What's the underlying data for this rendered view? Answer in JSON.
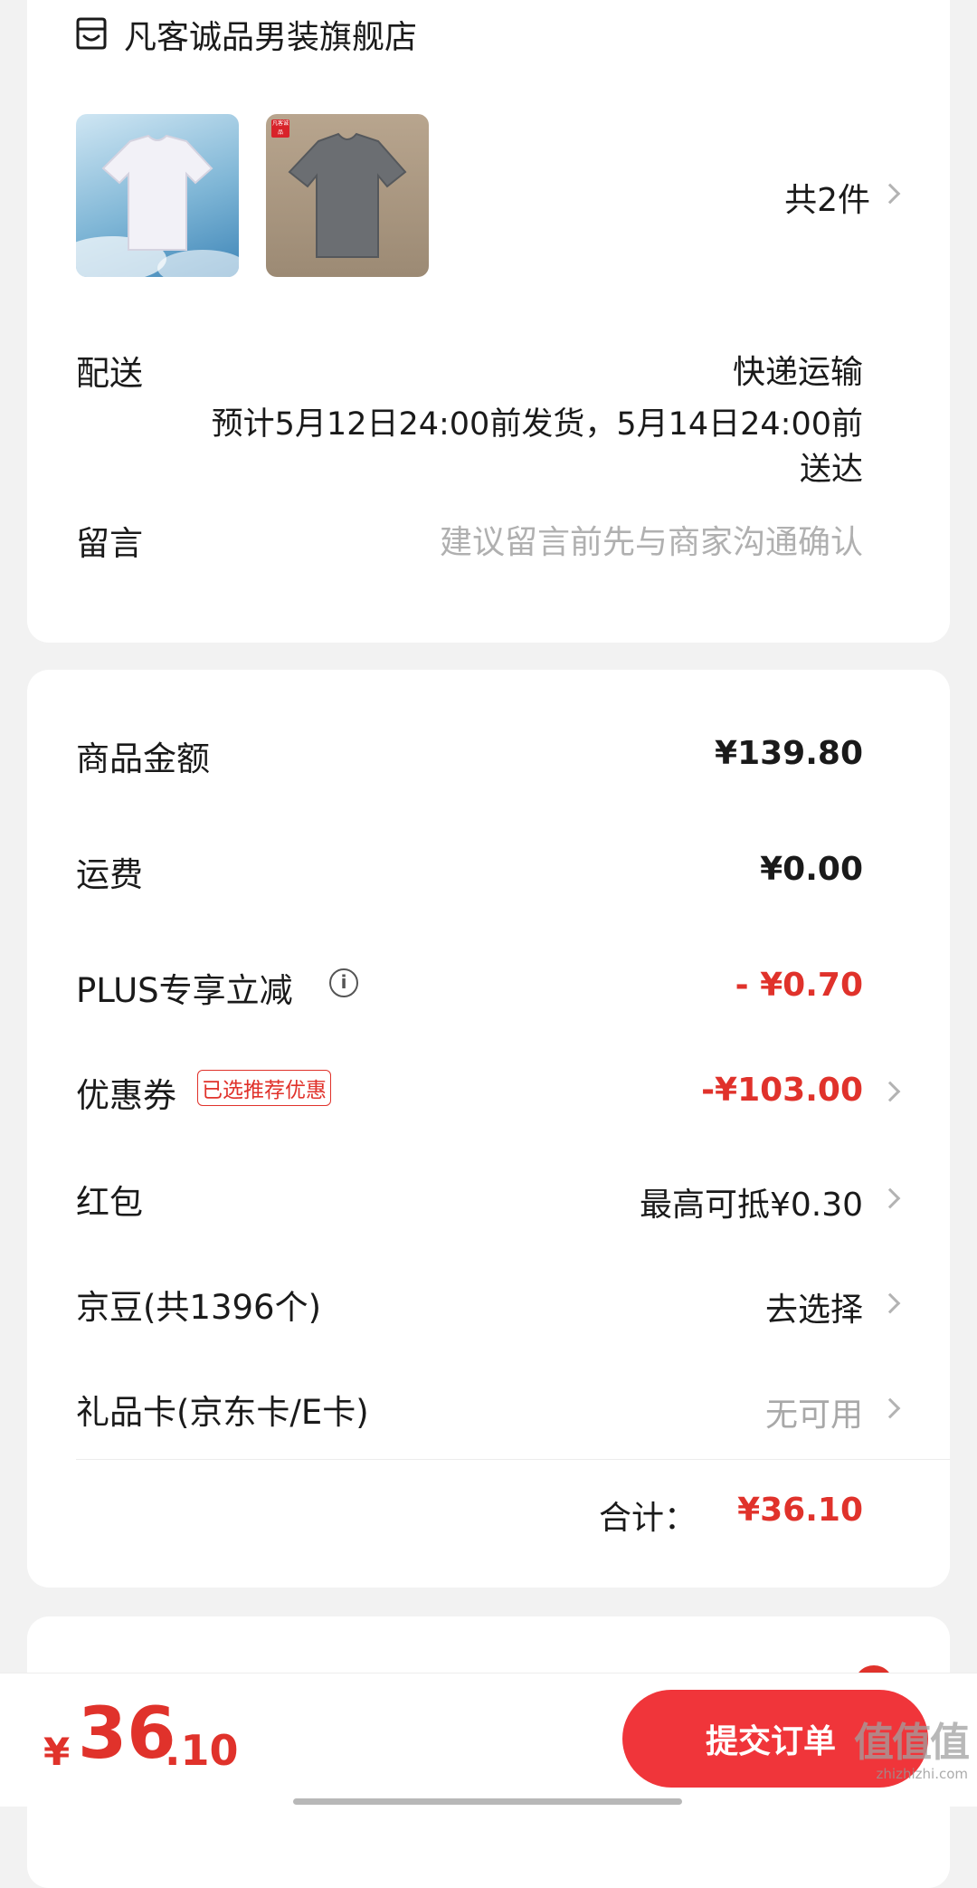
{
  "store": {
    "name": "凡客诚品男装旗舰店",
    "icon": "store-icon",
    "products": [
      {
        "color": "white-tshirt"
      },
      {
        "color": "gray-tshirt",
        "badge": "凡客诚品"
      }
    ],
    "count_label": "共2件"
  },
  "delivery": {
    "label": "配送",
    "method": "快递运输",
    "eta_line1": "预计5月12日24:00前发货，5月14日24:00前",
    "eta_line2": "送达"
  },
  "message": {
    "label": "留言",
    "placeholder": "建议留言前先与商家沟通确认"
  },
  "price": {
    "goods_label": "商品金额",
    "goods_value": "¥139.80",
    "shipping_label": "运费",
    "shipping_value": "¥0.00",
    "plus_label": "PLUS专享立减",
    "plus_value": "- ¥0.70",
    "coupon_label": "优惠券",
    "coupon_tag": "已选推荐优惠",
    "coupon_value": "-¥103.00",
    "redpacket_label": "红包",
    "redpacket_value": "最高可抵¥0.30",
    "jingdou_label": "京豆(共1396个)",
    "jingdou_value": "去选择",
    "giftcard_label": "礼品卡(京东卡/E卡)",
    "giftcard_value": "无可用",
    "total_label": "合计：",
    "total_value": "¥36.10"
  },
  "bottom_bar": {
    "currency": "¥",
    "amount_int": "36",
    "amount_dec": ".10",
    "submit_label": "提交订单",
    "watermark_main": "值值值",
    "watermark_url": "zhizhizhi.com"
  },
  "colors": {
    "accent": "#e0322b",
    "submit_bg": "#f0353a"
  }
}
